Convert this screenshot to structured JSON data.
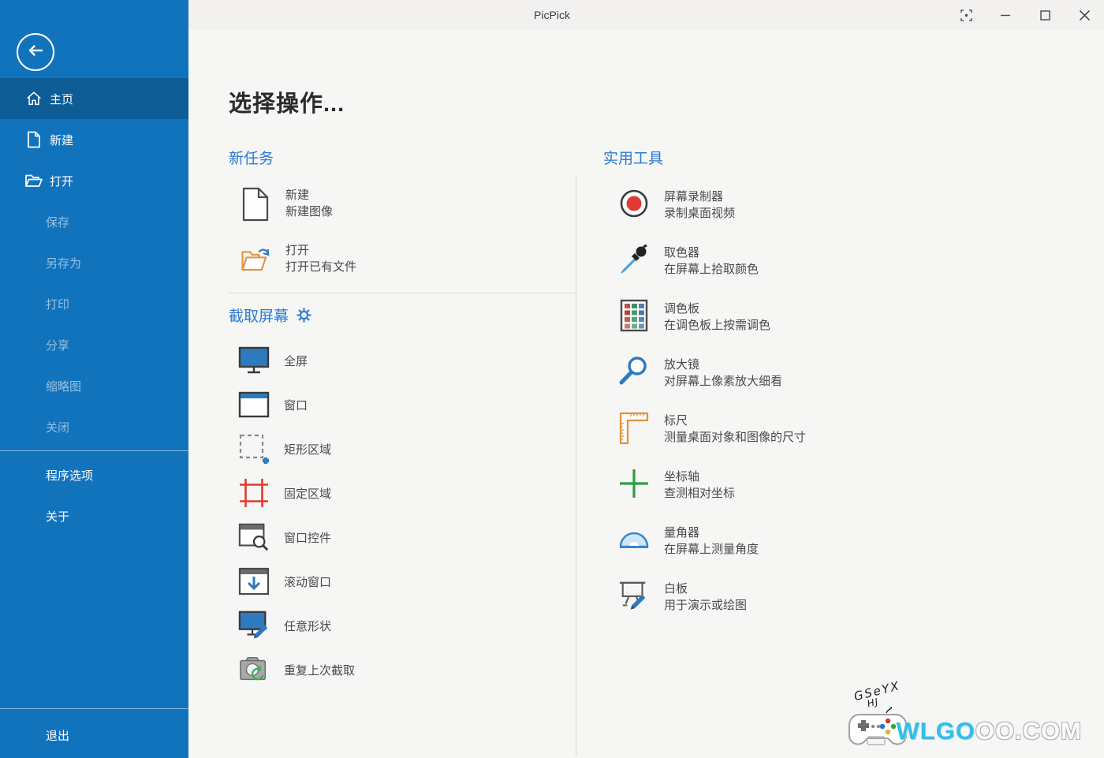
{
  "window": {
    "title": "PicPick"
  },
  "titlebar": {
    "icons": [
      "capture-corners-icon",
      "minimize-icon",
      "maximize-icon",
      "close-icon"
    ]
  },
  "sidebar": {
    "back_icon": "arrow-left-circle-icon",
    "items": [
      {
        "label": "主页",
        "icon": "home-icon",
        "selected": true
      },
      {
        "label": "新建",
        "icon": "new-document-icon"
      },
      {
        "label": "打开",
        "icon": "open-folder-icon"
      },
      {
        "label": "保存",
        "disabled": true
      },
      {
        "label": "另存为",
        "disabled": true
      },
      {
        "label": "打印",
        "disabled": true
      },
      {
        "label": "分享",
        "disabled": true
      },
      {
        "label": "缩略图",
        "disabled": true
      },
      {
        "label": "关闭",
        "disabled": true
      },
      {
        "label": "程序选项"
      },
      {
        "label": "关于"
      },
      {
        "label": "退出"
      }
    ]
  },
  "main": {
    "heading": "选择操作...",
    "new_task": {
      "header": "新任务",
      "items": [
        {
          "title": "新建",
          "subtitle": "新建图像",
          "icon": "new-image-icon"
        },
        {
          "title": "打开",
          "subtitle": "打开已有文件",
          "icon": "open-file-icon"
        }
      ]
    },
    "capture": {
      "header": "截取屏幕",
      "settings_icon": "gear-icon",
      "items": [
        "全屏",
        "窗口",
        "矩形区域",
        "固定区域",
        "窗口控件",
        "滚动窗口",
        "任意形状",
        "重复上次截取"
      ],
      "item_icons": [
        "fullscreen-icon",
        "window-icon",
        "rectangle-region-icon",
        "fixed-region-icon",
        "window-control-icon",
        "scrolling-window-icon",
        "freehand-icon",
        "repeat-capture-icon"
      ]
    },
    "tools": {
      "header": "实用工具",
      "items": [
        {
          "title": "屏幕录制器",
          "subtitle": "录制桌面视频",
          "icon": "screen-recorder-icon"
        },
        {
          "title": "取色器",
          "subtitle": "在屏幕上拾取颜色",
          "icon": "color-picker-icon"
        },
        {
          "title": "调色板",
          "subtitle": "在调色板上按需调色",
          "icon": "color-palette-icon"
        },
        {
          "title": "放大镜",
          "subtitle": "对屏幕上像素放大细看",
          "icon": "magnifier-icon"
        },
        {
          "title": "标尺",
          "subtitle": "测量桌面对象和图像的尺寸",
          "icon": "ruler-icon"
        },
        {
          "title": "坐标轴",
          "subtitle": "查测相对坐标",
          "icon": "crosshair-icon"
        },
        {
          "title": "量角器",
          "subtitle": "在屏幕上测量角度",
          "icon": "protractor-icon"
        },
        {
          "title": "白板",
          "subtitle": "用于演示或绘图",
          "icon": "whiteboard-icon"
        }
      ]
    }
  },
  "watermark": {
    "scribble_line1": "GSeYX",
    "scribble_line2": "HJ",
    "site_primary": "WLGO",
    "site_secondary": "OO.COM",
    "controller_icon": "game-controller-icon"
  },
  "colors": {
    "sidebar": "#1273bd",
    "sidebar_selected": "#0d5c96",
    "section_header_blue": "#2a7ad4",
    "titlebar": "#f2f1f0",
    "content_bg": "#f6f6f5",
    "record_red": "#e23b36",
    "fixed_region_red": "#e03b30",
    "crosshair_green": "#2f9e44",
    "watermark_cyan": "#35bde8"
  }
}
